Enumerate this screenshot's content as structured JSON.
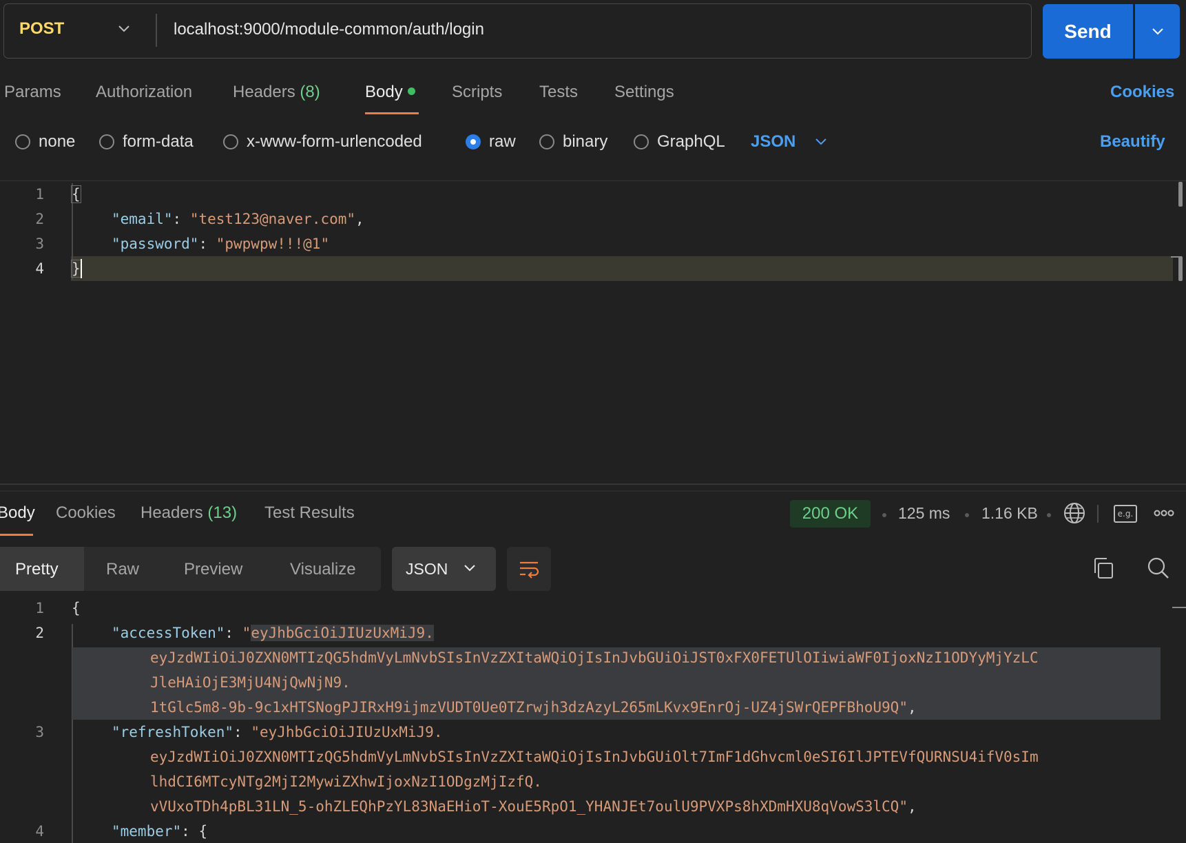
{
  "request": {
    "method": "POST",
    "url": "localhost:9000/module-common/auth/login",
    "send_label": "Send"
  },
  "request_tabs": {
    "params": "Params",
    "authorization": "Authorization",
    "headers": "Headers",
    "headers_count": "(8)",
    "body": "Body",
    "scripts": "Scripts",
    "tests": "Tests",
    "settings": "Settings",
    "cookies": "Cookies"
  },
  "body_types": {
    "none": "none",
    "form_data": "form-data",
    "urlencoded": "x-www-form-urlencoded",
    "raw": "raw",
    "binary": "binary",
    "graphql": "GraphQL",
    "selected": "raw",
    "format": "JSON",
    "beautify": "Beautify"
  },
  "request_editor": {
    "line_numbers": [
      "1",
      "2",
      "3",
      "4"
    ],
    "open_brace": "{",
    "close_brace": "}",
    "email_key": "\"email\"",
    "email_value": "\"test123@naver.com\"",
    "password_key": "\"password\"",
    "password_value": "\"pwpwpw!!!@1\""
  },
  "response_tabs": {
    "body": "Body",
    "cookies": "Cookies",
    "headers": "Headers",
    "headers_count": "(13)",
    "test_results": "Test Results"
  },
  "response_meta": {
    "status": "200 OK",
    "time": "125 ms",
    "size": "1.16 KB"
  },
  "response_view": {
    "pretty": "Pretty",
    "raw": "Raw",
    "preview": "Preview",
    "visualize": "Visualize",
    "format": "JSON"
  },
  "response_editor": {
    "line_numbers": [
      "1",
      "2",
      "3",
      "4"
    ],
    "open_brace": "{",
    "access_key": "\"accessToken\"",
    "access_line1": "eyJhbGciOiJIUzUxMiJ9.",
    "access_line2": "eyJzdWIiOiJ0ZXN0MTIzQG5hdmVyLmNvbSIsInVzZXItaWQiOjIsInJvbGUiOiJST0xFX0FETUlOIiwiaWF0IjoxNzI1ODYyMjYzLC",
    "access_line3": "JleHAiOjE3MjU4NjQwNjN9.",
    "access_line4": "1tGlc5m8-9b-9c1xHTSNogPJIRxH9ijmzVUDT0Ue0TZrwjh3dzAzyL265mLKvx9EnrOj-UZ4jSWrQEPFBhoU9Q",
    "refresh_key": "\"refreshToken\"",
    "refresh_line1": "\"eyJhbGciOiJIUzUxMiJ9.",
    "refresh_line2": "eyJzdWIiOiJ0ZXN0MTIzQG5hdmVyLmNvbSIsInVzZXItaWQiOjIsInJvbGUiOlt7ImF1dGhvcml0eSI6IlJPTEVfQURNSU4ifV0sIm",
    "refresh_line3": "lhdCI6MTcyNTg2MjI2MywiZXhwIjoxNzI1ODgzMjIzfQ.",
    "refresh_line4": "vVUxoTDh4pBL31LN_5-ohZLEQhPzYL83NaEHioT-XouE5RpO1_YHANJEt7oulU9PVXPs8hXDmHXU8qVowS3lCQ",
    "member_key": "\"member\""
  }
}
